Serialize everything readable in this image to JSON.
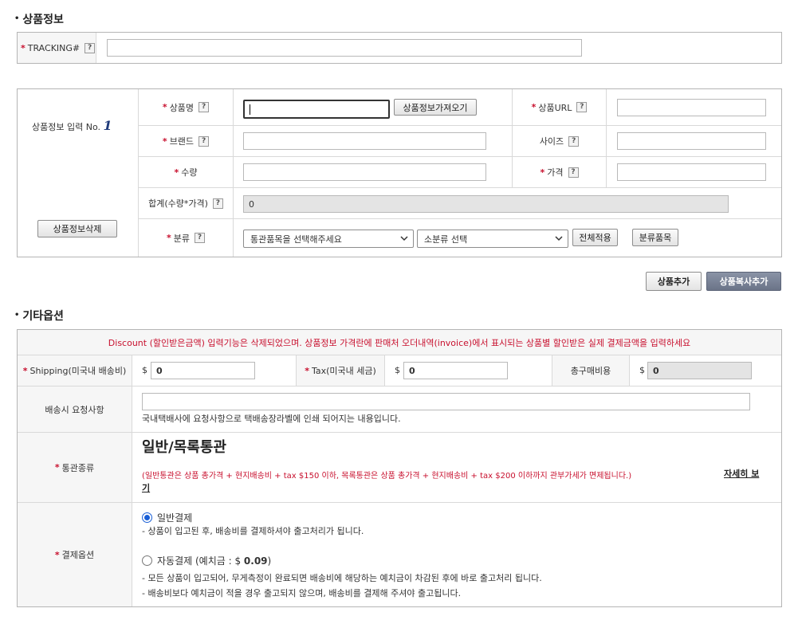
{
  "sections": {
    "product_info_title": "상품정보",
    "other_options_title": "기타옵션"
  },
  "tracking": {
    "label": "TRACKING#",
    "value": ""
  },
  "product_item": {
    "header_label": "상품정보 입력 No.",
    "number": "1",
    "delete_button": "상품정보삭제",
    "name_label": "상품명",
    "fetch_button": "상품정보가져오기",
    "url_label": "상품URL",
    "brand_label": "브랜드",
    "size_label": "사이즈",
    "qty_label": "수량",
    "price_label": "가격",
    "total_label": "합계(수량*가격)",
    "total_value": "0",
    "category_label": "분류",
    "category_select": "통관품목을 선택해주세요",
    "subcategory_select": "소분류 선택",
    "apply_all_button": "전체적용",
    "category_items_button": "분류품목"
  },
  "actions": {
    "add_product": "상품추가",
    "copy_add_product": "상품복사추가"
  },
  "options": {
    "discount_notice": "Discount (할인받은금액) 입력기능은 삭제되었으며. 상품정보 가격란에 판매처 오더내역(invoice)에서 표시되는 상품별 할인받은 실제 결제금액을 입력하세요",
    "shipping_label": "Shipping(미국내 배송비)",
    "currency": "$",
    "shipping_value": "0",
    "tax_label": "Tax(미국내 세금)",
    "tax_value": "0",
    "total_purchase_label": "총구매비용",
    "total_purchase_value": "0",
    "delivery_request_label": "배송시 요청사항",
    "delivery_request_value": "",
    "delivery_request_note": "국내택배사에 요청사항으로 택배송장라벨에 인쇄 되어지는 내용입니다.",
    "customs_label": "통관종류",
    "customs_type": "일반/목록통관",
    "customs_note": "(일반통관은 상품 총가격 + 현지배송비 + tax $150 이하, 목록통관은 상품 총가격 + 현지배송비 + tax  $200 이하까지 관부가세가 면제됩니다.)",
    "customs_more": "자세히 보기",
    "payment_label": "결제옵션",
    "payment_normal": "일반결제",
    "payment_normal_desc": "- 상품이 입고된 후, 배송비를 결제하셔야 출고처리가 됩니다.",
    "payment_auto": "자동결제 (예치금 : $ ",
    "payment_auto_amount": "0.09",
    "payment_auto_close": ")",
    "payment_auto_desc1": "- 모든 상품이 입고되어, 무게측정이 완료되면 배송비에 해당하는 예치금이 차감된 후에 바로 출고처리 됩니다.",
    "payment_auto_desc2": "- 배송비보다 예치금이 적을 경우 출고되지 않으며, 배송비를 결제해 주셔야 출고됩니다."
  },
  "colors": {
    "required": "#c8102e",
    "primary_button": "#6b7488",
    "radio_selected": "#1a5fd6"
  },
  "icons": {
    "help": "?"
  }
}
